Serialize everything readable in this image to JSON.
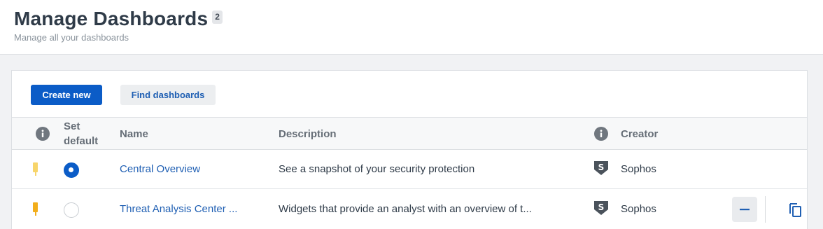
{
  "header": {
    "title": "Manage Dashboards",
    "count": "2",
    "subtitle": "Manage all your dashboards"
  },
  "toolbar": {
    "create_label": "Create new",
    "find_label": "Find dashboards"
  },
  "table": {
    "columns": {
      "set_default_line1": "Set",
      "set_default_line2": "default",
      "name": "Name",
      "description": "Description",
      "creator": "Creator"
    },
    "rows": [
      {
        "name": "Central Overview",
        "description": "See a snapshot of your security protection",
        "creator": "Sophos",
        "is_default": true,
        "pinned": false
      },
      {
        "name": "Threat Analysis Center ...",
        "description": "Widgets that provide an analyst with an overview of t...",
        "creator": "Sophos",
        "is_default": false,
        "pinned": true
      }
    ]
  },
  "icons": {
    "info": "info-icon",
    "pin": "pin-icon",
    "creator_logo": "sophos-shield-icon",
    "remove": "minus-icon",
    "copy": "copy-icon"
  },
  "colors": {
    "accent": "#0b5cc7",
    "link": "#1f5fb3",
    "pin_light": "#f7d56b",
    "pin_strong": "#f2ae1c"
  }
}
